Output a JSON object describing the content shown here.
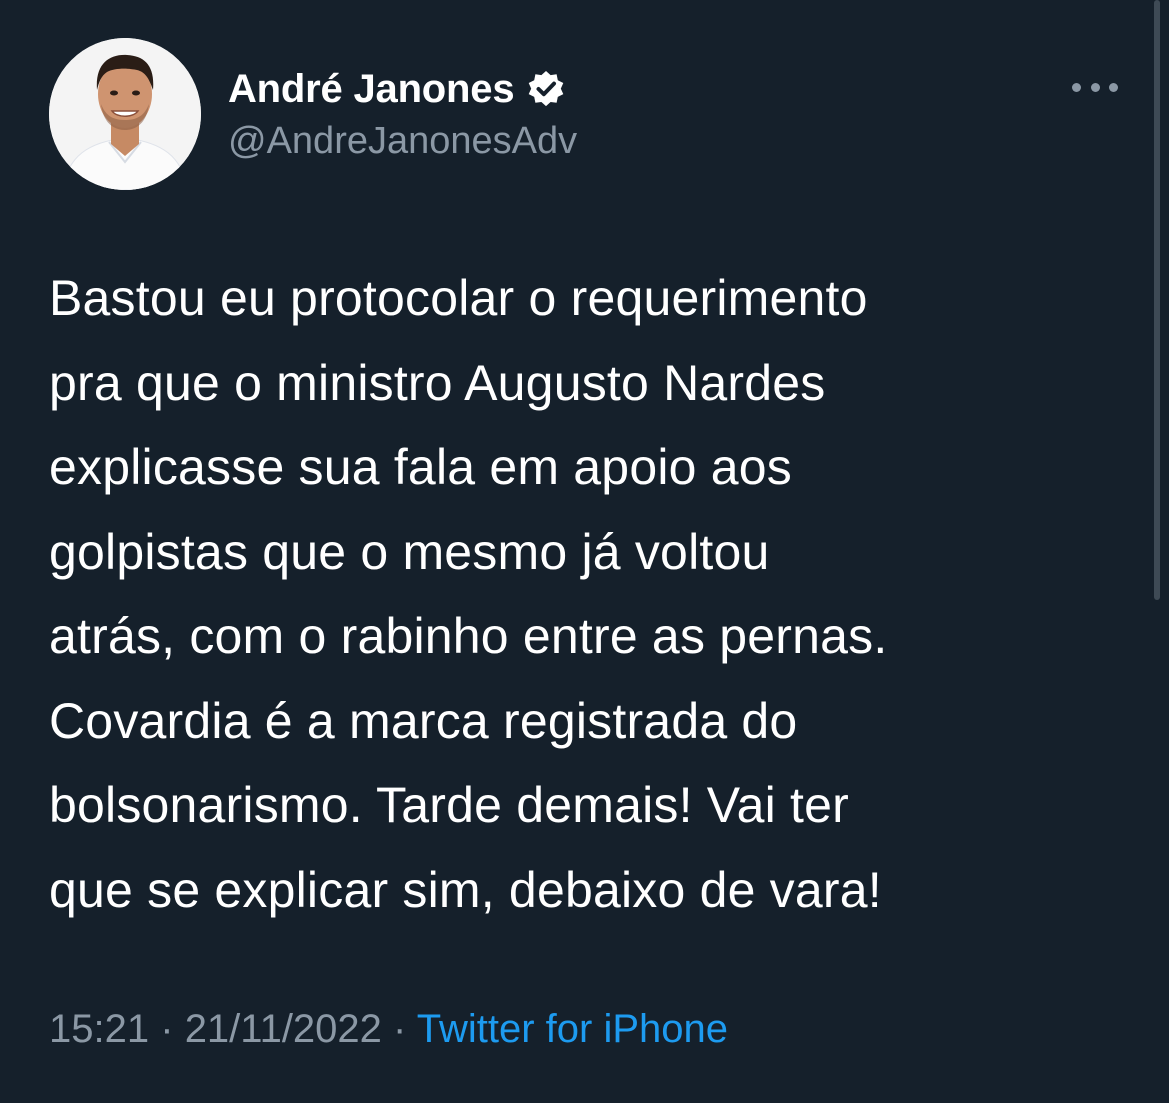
{
  "author": {
    "display_name": "André Janones",
    "handle": "@AndreJanonesAdv",
    "verified": true,
    "avatar": "profile-photo"
  },
  "tweet": {
    "text": "Bastou eu protocolar o requerimento\npra que o ministro Augusto Nardes\nexplicasse sua fala em apoio aos\ngolpistas que o mesmo já voltou\natrás, com o rabinho entre as pernas.\nCovardia é a marca registrada do\nbolsonarismo. Tarde demais! Vai ter\nque se explicar sim, debaixo de vara!",
    "time": "15:21",
    "separator": "·",
    "date": "21/11/2022",
    "source": "Twitter for iPhone"
  },
  "icons": {
    "verified": "verified-badge-icon",
    "more": "more-options-icon"
  },
  "colors": {
    "background": "#15202b",
    "primary_text": "#ffffff",
    "secondary_text": "#8b98a5",
    "link": "#1d9bf0"
  }
}
